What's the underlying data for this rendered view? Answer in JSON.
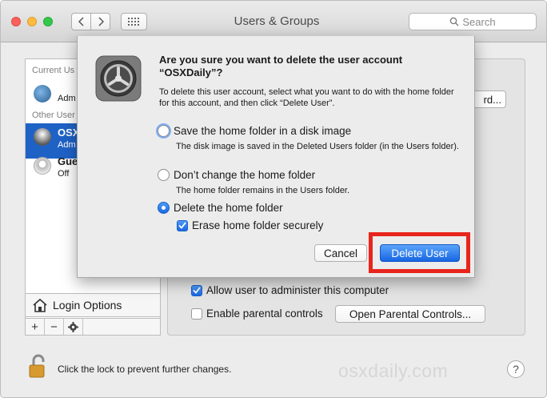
{
  "window": {
    "title": "Users & Groups"
  },
  "toolbar": {
    "search_placeholder": "Search",
    "icons": {
      "back": "chevron-left-icon",
      "forward": "chevron-right-icon",
      "grid": "grid-icon",
      "search": "search-icon"
    }
  },
  "sidebar": {
    "current_header": "Current Us",
    "current_user": {
      "sub": "Adm"
    },
    "other_header": "Other User",
    "users": [
      {
        "name": "OSX",
        "sub": "Adm",
        "selected": true
      },
      {
        "name": "Gue",
        "sub": "Off",
        "selected": false
      }
    ],
    "login_options": "Login Options",
    "add": "+",
    "remove": "−"
  },
  "main": {
    "password_button_fragment": "rd...",
    "allow_admin_label": "Allow user to administer this computer",
    "allow_admin_checked": true,
    "parental_label": "Enable parental controls",
    "parental_checked": false,
    "parental_button": "Open Parental Controls..."
  },
  "footer": {
    "lock_text": "Click the lock to prevent further changes.",
    "watermark": "osxdaily.com",
    "help": "?"
  },
  "dialog": {
    "title": "Are you sure you want to delete the user account “OSXDaily”?",
    "description": "To delete this user account, select what you want to do with the home folder for this account, and then click “Delete User”.",
    "options": [
      {
        "label": "Save the home folder in a disk image",
        "note": "The disk image is saved in the Deleted Users folder (in the Users folder).",
        "selected": false
      },
      {
        "label": "Don’t change the home folder",
        "note": "The home folder remains in the Users folder.",
        "selected": false
      },
      {
        "label": "Delete the home folder",
        "note": "",
        "selected": true
      }
    ],
    "erase_label": "Erase home folder securely",
    "erase_checked": true,
    "cancel": "Cancel",
    "delete": "Delete User"
  },
  "colors": {
    "accent": "#1f62c6",
    "highlight": "#e8251d"
  }
}
